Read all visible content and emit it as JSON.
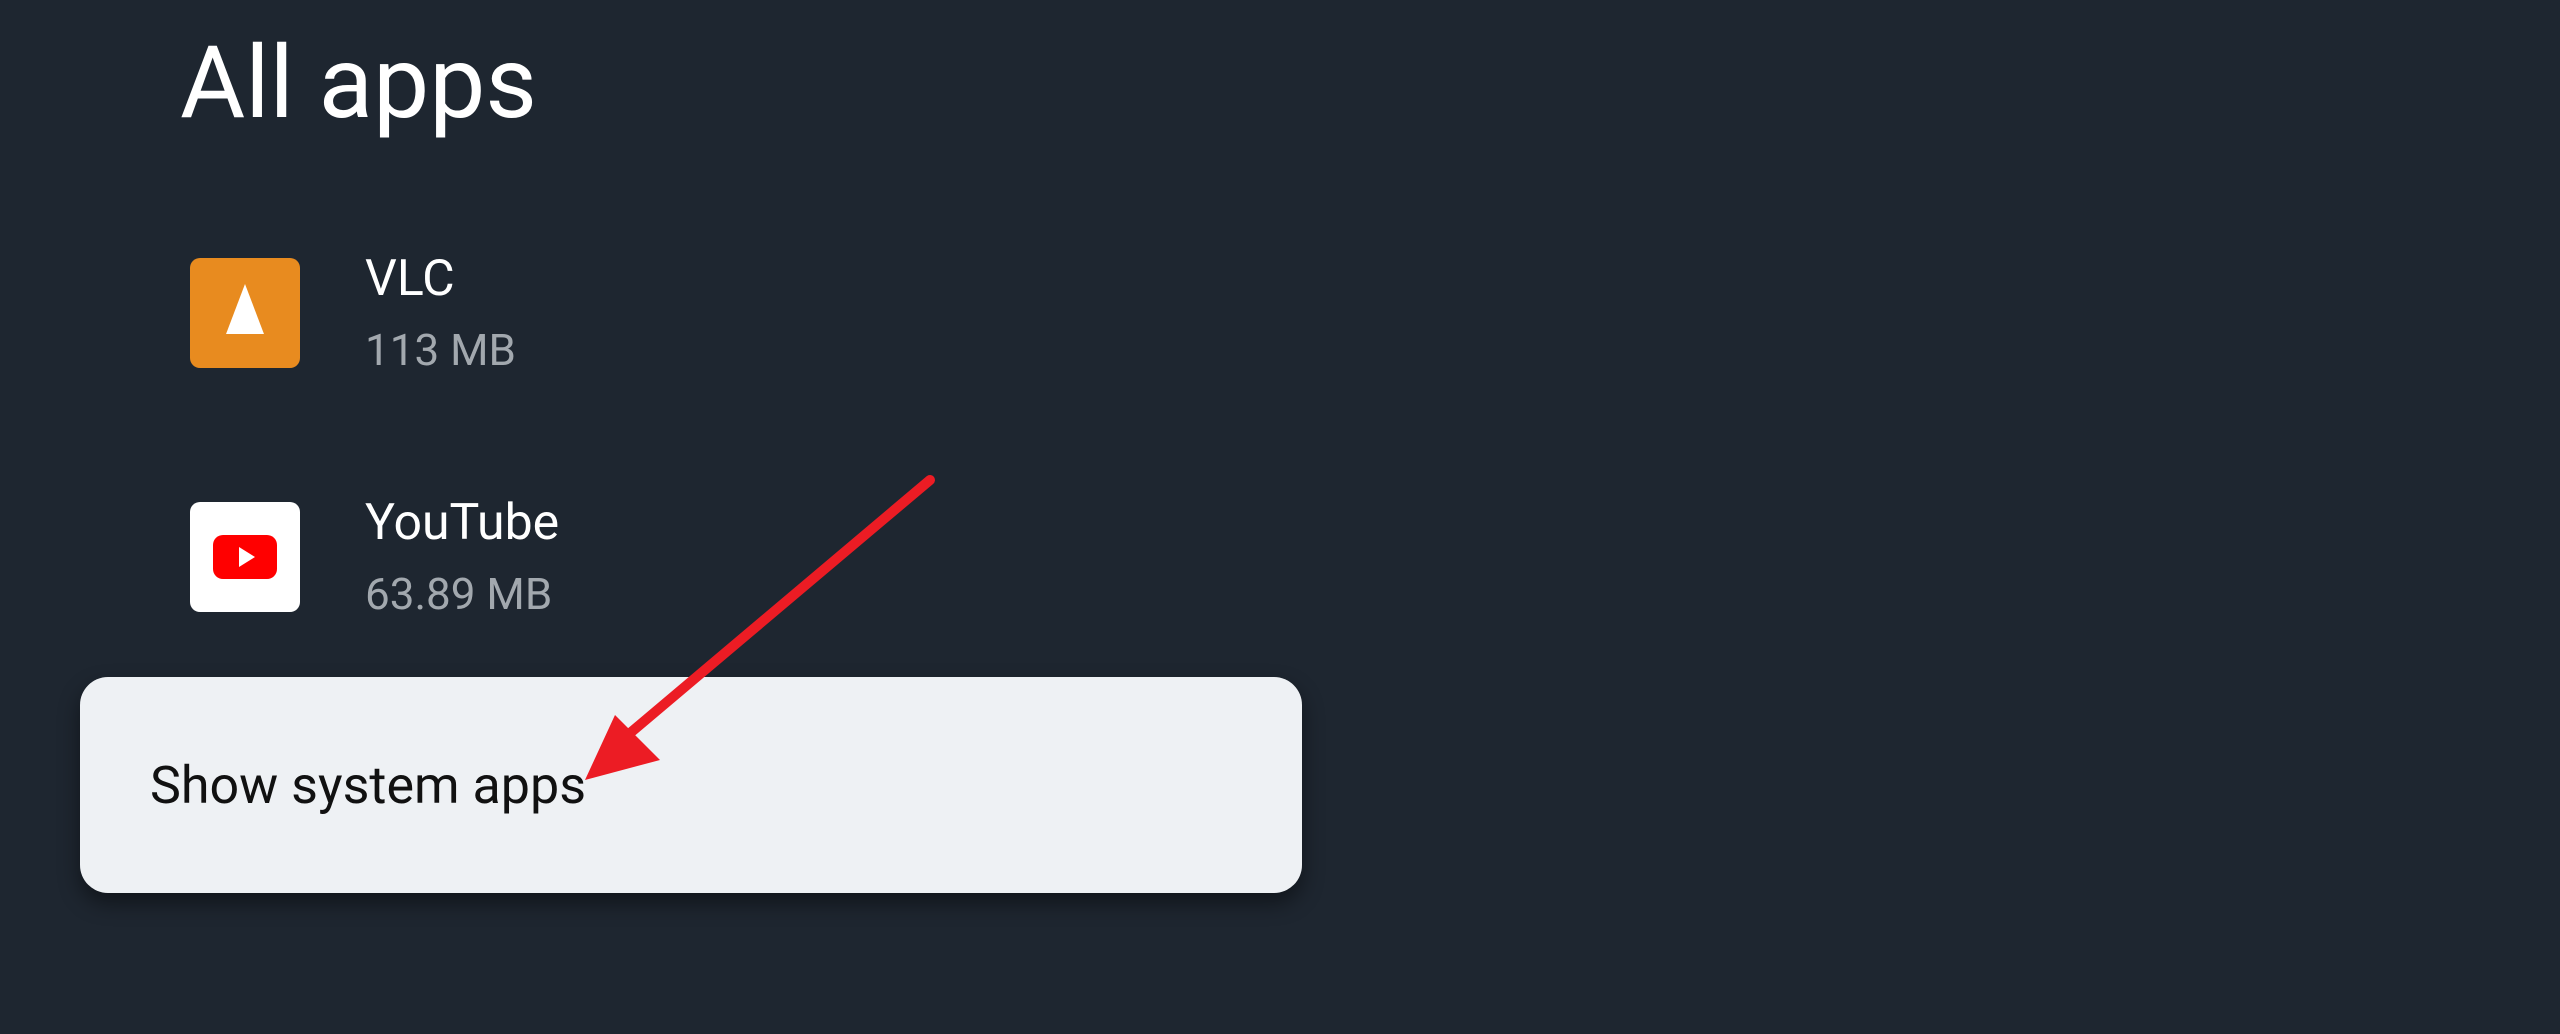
{
  "header": {
    "title": "All apps"
  },
  "apps": [
    {
      "name": "VLC",
      "size": "113 MB",
      "icon": "vlc-icon"
    },
    {
      "name": "YouTube",
      "size": "63.89 MB",
      "icon": "youtube-icon"
    }
  ],
  "actions": {
    "show_system_apps_label": "Show system apps"
  }
}
